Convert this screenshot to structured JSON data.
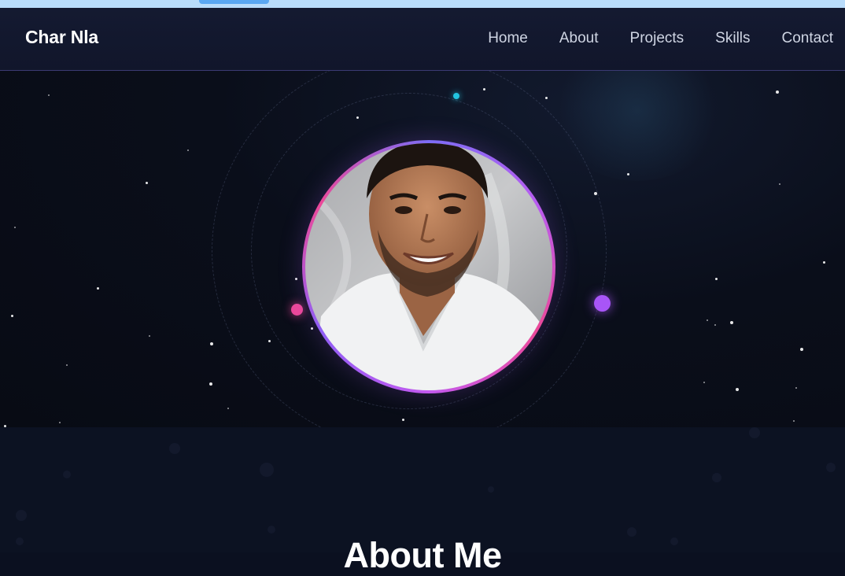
{
  "navbar": {
    "brand": "Char Nla",
    "links": [
      "Home",
      "About",
      "Projects",
      "Skills",
      "Contact"
    ]
  },
  "hero": {
    "avatar_alt": "Profile photo of smiling man in white t-shirt"
  },
  "about": {
    "title": "About Me"
  },
  "colors": {
    "background": "#0b1020",
    "navbar": "#141a31",
    "accent_pink": "#ec4899",
    "accent_purple": "#a855f7",
    "accent_cyan": "#22c5e0",
    "nav_text": "#cfd5e3"
  }
}
